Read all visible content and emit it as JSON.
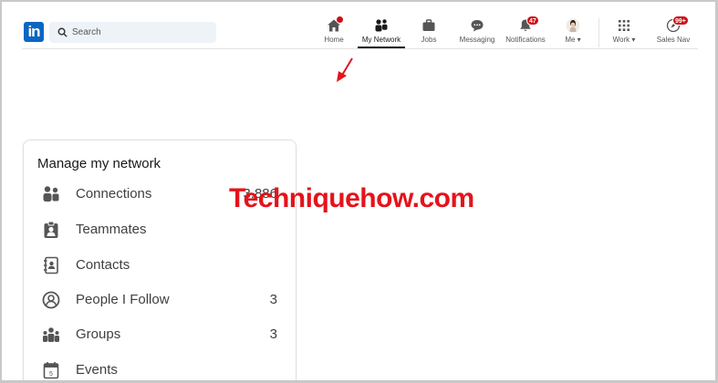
{
  "brand": {
    "logo_text": "in",
    "accent": "#0a66c2"
  },
  "search": {
    "placeholder": "Search"
  },
  "nav": {
    "home": {
      "label": "Home"
    },
    "network": {
      "label": "My Network"
    },
    "jobs": {
      "label": "Jobs"
    },
    "messaging": {
      "label": "Messaging"
    },
    "notifications": {
      "label": "Notifications",
      "badge": "47"
    },
    "me": {
      "label": "Me"
    },
    "work": {
      "label": "Work"
    },
    "sales_nav": {
      "label": "Sales Nav",
      "badge": "99+"
    }
  },
  "card": {
    "title": "Manage my network",
    "items": [
      {
        "label": "Connections",
        "count": "3,886",
        "icon": "connections-icon"
      },
      {
        "label": "Teammates",
        "count": "",
        "icon": "teammates-icon"
      },
      {
        "label": "Contacts",
        "count": "",
        "icon": "contacts-icon"
      },
      {
        "label": "People I Follow",
        "count": "3",
        "icon": "people-follow-icon"
      },
      {
        "label": "Groups",
        "count": "3",
        "icon": "groups-icon"
      },
      {
        "label": "Events",
        "count": "",
        "icon": "events-icon"
      }
    ]
  },
  "watermark": {
    "text": "Techniquehow.com",
    "color": "#e4131b"
  }
}
